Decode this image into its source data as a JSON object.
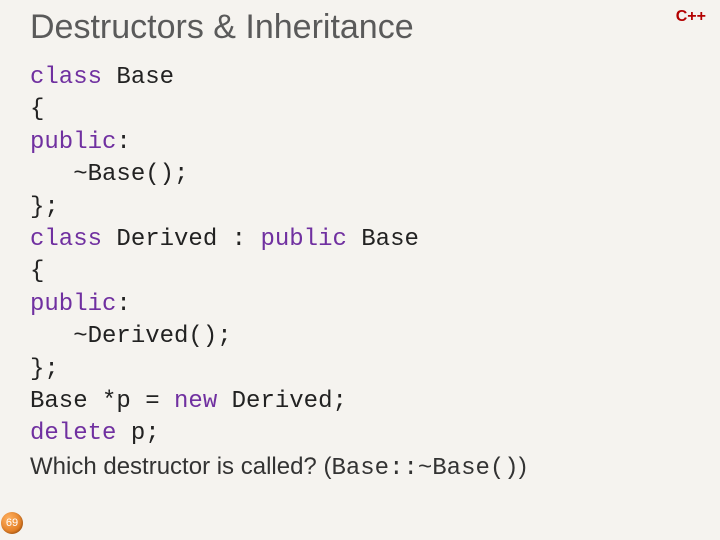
{
  "header": {
    "title": "Destructors & Inheritance",
    "language_badge": "C++"
  },
  "code": {
    "lines": [
      [
        {
          "t": "class",
          "kw": true
        },
        {
          "t": " Base"
        }
      ],
      [
        {
          "t": "{"
        }
      ],
      [
        {
          "t": "public",
          "kw": true
        },
        {
          "t": ":"
        }
      ],
      [
        {
          "t": "   ~Base();"
        }
      ],
      [
        {
          "t": "};"
        }
      ],
      [
        {
          "t": "class",
          "kw": true
        },
        {
          "t": " Derived : "
        },
        {
          "t": "public",
          "kw": true
        },
        {
          "t": " Base"
        }
      ],
      [
        {
          "t": "{"
        }
      ],
      [
        {
          "t": "public",
          "kw": true
        },
        {
          "t": ":"
        }
      ],
      [
        {
          "t": "   ~Derived();"
        }
      ],
      [
        {
          "t": "};"
        }
      ],
      [
        {
          "t": "Base *p = "
        },
        {
          "t": "new",
          "kw": true
        },
        {
          "t": " Derived;"
        }
      ],
      [
        {
          "t": "delete",
          "kw": true
        },
        {
          "t": " p;"
        }
      ]
    ]
  },
  "question": {
    "text_prefix": "Which destructor is called? (",
    "mono_part": "Base::~Base()",
    "text_suffix": ")"
  },
  "footer": {
    "page_number": "69"
  }
}
